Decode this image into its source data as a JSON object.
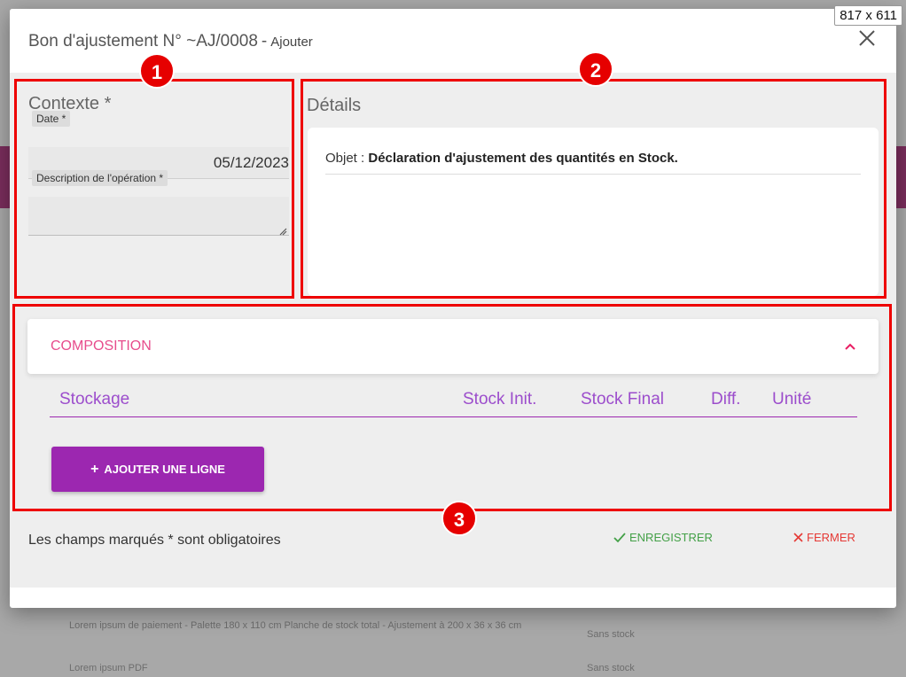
{
  "overlay_badge": "817 x 611",
  "background_page": {
    "row1_text": "Lorem ipsum de paiement - Palette 180 x 110 cm Planche de stock total - Ajustement à 200 x 36 x 36 cm",
    "row1_value": "Sans stock",
    "row2_text": "Lorem ipsum PDF",
    "row2_value": "Sans stock"
  },
  "dialog": {
    "title": "Bon d'ajustement N° ~AJ/0008",
    "separator": "-",
    "mode": "Ajouter",
    "close_icon": "close-icon"
  },
  "context": {
    "title": "Contexte *",
    "date_label": "Date *",
    "date_value": "05/12/2023",
    "description_label": "Description de l'opération *",
    "description_value": ""
  },
  "details": {
    "title": "Détails",
    "objet_label": "Objet :",
    "objet_value": "Déclaration d'ajustement des quantités en Stock."
  },
  "composition": {
    "title": "COMPOSITION",
    "columns": [
      "Stockage",
      "Stock Init.",
      "Stock Final",
      "Diff.",
      "Unité"
    ],
    "add_button_icon": "+",
    "add_button_label": "AJOUTER UNE LIGNE"
  },
  "footer": {
    "required_note": "Les champs marqués * sont obligatoires",
    "save_label": "ENREGISTRER",
    "close_label": "FERMER"
  },
  "annotations": [
    "1",
    "2",
    "3"
  ],
  "colors": {
    "accent": "#9c27b0",
    "composition_title": "#e74c8c",
    "save": "#43a047",
    "close": "#e53935",
    "annotation": "#e60000"
  }
}
